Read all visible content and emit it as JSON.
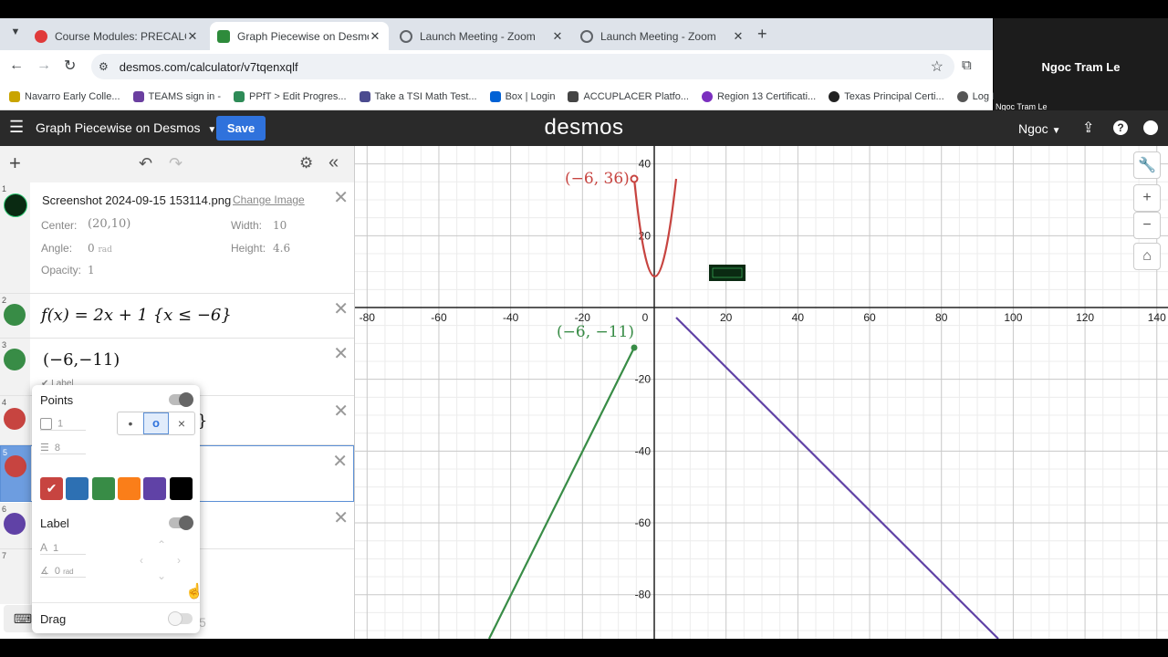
{
  "browser": {
    "tabs": [
      {
        "title": "Course Modules: PRECALCULUS",
        "icon": "canvas-icon",
        "color": "#e03a3a"
      },
      {
        "title": "Graph Piecewise on Desmos | D",
        "icon": "desmos-icon",
        "color": "#2e8b3b"
      },
      {
        "title": "Launch Meeting - Zoom",
        "icon": "globe-icon",
        "color": "#5f6368"
      },
      {
        "title": "Launch Meeting - Zoom",
        "icon": "globe-icon",
        "color": "#5f6368"
      }
    ],
    "url": "desmos.com/calculator/v7tqenxqlf",
    "bookmarks": [
      {
        "label": "Navarro Early Colle...",
        "color": "#c9a400"
      },
      {
        "label": "TEAMS sign in -",
        "color": "#6b3fa0"
      },
      {
        "label": "PPfT > Edit Progres...",
        "color": "#2e8b57"
      },
      {
        "label": "Take a TSI Math Test...",
        "color": "#4b4b8f"
      },
      {
        "label": "Box | Login",
        "color": "#0061d5"
      },
      {
        "label": "ACCUPLACER Platfo...",
        "color": "#444"
      },
      {
        "label": "Region 13 Certificati...",
        "color": "#7b2fbf"
      },
      {
        "label": "Texas Principal Certi...",
        "color": "#222"
      },
      {
        "label": "Log In - AVID Center",
        "color": "#555"
      }
    ]
  },
  "zoom": {
    "name_large": "Ngoc Tram Le",
    "name_small": "Ngoc Tram Le"
  },
  "desmos": {
    "title": "Graph Piecewise on Desmos",
    "save_label": "Save",
    "logo": "desmos",
    "user": "Ngoc"
  },
  "expressions": {
    "e1": {
      "num": "1",
      "filename": "Screenshot 2024-09-15 153114.png",
      "change_image": "Change Image",
      "center_label": "Center:",
      "center_value": "(20,10)",
      "width_label": "Width:",
      "width_value": "10",
      "angle_label": "Angle:",
      "angle_value": "0",
      "angle_unit": "rad",
      "height_label": "Height:",
      "height_value": "4.6",
      "opacity_label": "Opacity:",
      "opacity_value": "1"
    },
    "e2": {
      "num": "2",
      "latex": "f(x) = 2x + 1 {x ≤ −6}"
    },
    "e3": {
      "num": "3",
      "latex": "(−6,−11)",
      "label_check": "Label"
    },
    "e4": {
      "num": "4",
      "tail": "}"
    },
    "e5": {
      "num": "5"
    },
    "e6": {
      "num": "6"
    },
    "e7": {
      "num": "7"
    },
    "tail_digit": "5"
  },
  "popup": {
    "points_label": "Points",
    "opacity_value": "1",
    "size_value": "8",
    "style_dot": "•",
    "style_open": "o",
    "style_cross": "×",
    "colors": [
      "#c74440",
      "#2d70b3",
      "#388c46",
      "#fa7e19",
      "#6042a6",
      "#000000"
    ],
    "label_label": "Label",
    "label_size": "1",
    "label_angle": "0",
    "label_angle_unit": "rad",
    "drag_label": "Drag"
  },
  "graph": {
    "x_ticks": [
      "-80",
      "-60",
      "-40",
      "-20",
      "0",
      "20",
      "40",
      "60",
      "80",
      "100",
      "120",
      "140"
    ],
    "y_ticks": [
      "40",
      "20",
      "-20",
      "-40",
      "-60",
      "-80"
    ],
    "point_labels": [
      {
        "text": "(−6, 36)",
        "color": "#c74440"
      },
      {
        "text": "(−6, −11)",
        "color": "#388c46"
      }
    ],
    "series_colors": {
      "red": "#c74440",
      "green": "#388c46",
      "purple": "#6042a6"
    }
  }
}
